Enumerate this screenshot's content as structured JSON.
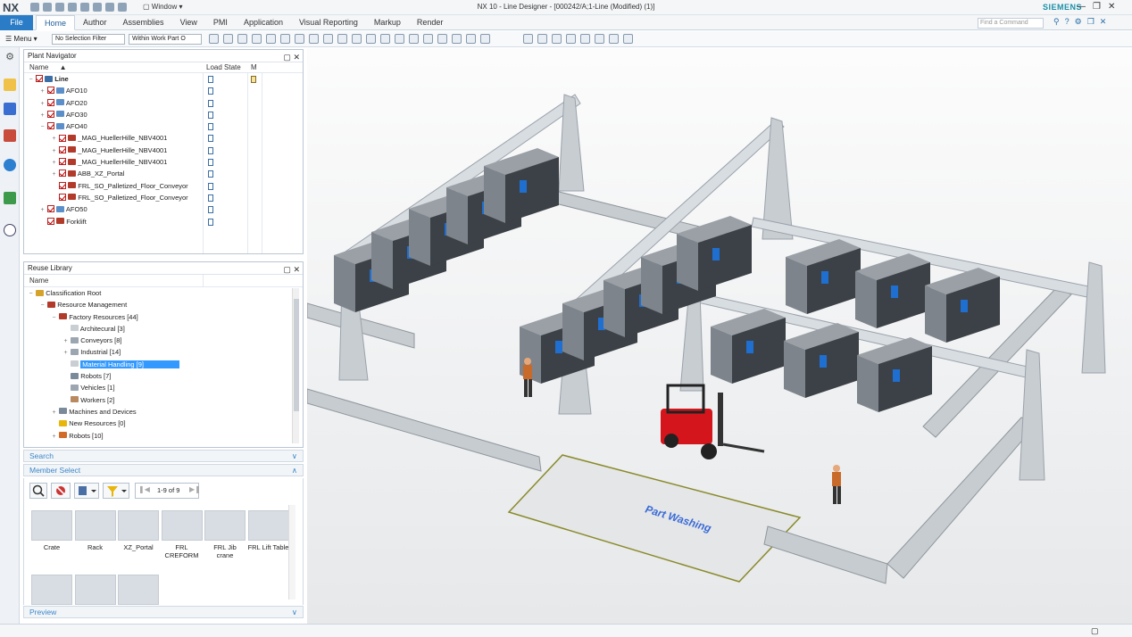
{
  "app": {
    "logo": "NX",
    "title": "NX 10 - Line Designer - [000242/A;1-Line (Modified)  (1)]",
    "brand": "SIEMENS",
    "window_menu": "Window"
  },
  "ribbon": {
    "file_tab": "File",
    "tabs": [
      "Home",
      "Author",
      "Assemblies",
      "View",
      "PMI",
      "Application",
      "Visual Reporting",
      "Markup",
      "Render"
    ],
    "active_tab": "Home",
    "find_command_placeholder": "Find a Command"
  },
  "toolbar": {
    "menu_label": "Menu",
    "selection_filter": "No Selection Filter",
    "scope": "Within Work Part O"
  },
  "plant_navigator": {
    "title": "Plant Navigator",
    "columns": {
      "name": "Name",
      "load_state": "Load State",
      "m": "M"
    },
    "rows": [
      {
        "label": "Line",
        "level": 0,
        "expander": "−",
        "icon": "line-icon"
      },
      {
        "label": "AFO10",
        "level": 1,
        "expander": "+",
        "icon": "station-icon"
      },
      {
        "label": "AFO20",
        "level": 1,
        "expander": "+",
        "icon": "station-icon"
      },
      {
        "label": "AFO30",
        "level": 1,
        "expander": "+",
        "icon": "station-icon"
      },
      {
        "label": "AFO40",
        "level": 1,
        "expander": "−",
        "icon": "station-icon"
      },
      {
        "label": "_MAG_HuellerHille_NBV4001",
        "level": 2,
        "expander": "+",
        "icon": "machine-icon"
      },
      {
        "label": "_MAG_HuellerHille_NBV4001",
        "level": 2,
        "expander": "+",
        "icon": "machine-icon"
      },
      {
        "label": "_MAG_HuellerHille_NBV4001",
        "level": 2,
        "expander": "+",
        "icon": "machine-icon"
      },
      {
        "label": "ABB_XZ_Portal",
        "level": 2,
        "expander": "+",
        "icon": "machine-icon"
      },
      {
        "label": "FRL_SO_Palletized_Floor_Conveyor",
        "level": 2,
        "expander": "",
        "icon": "machine-icon"
      },
      {
        "label": "FRL_SO_Palletized_Floor_Conveyor",
        "level": 2,
        "expander": "",
        "icon": "machine-icon"
      },
      {
        "label": "AFO50",
        "level": 1,
        "expander": "+",
        "icon": "station-icon"
      },
      {
        "label": "Forklift",
        "level": 1,
        "expander": "",
        "icon": "machine-icon"
      }
    ]
  },
  "reuse_library": {
    "title": "Reuse Library",
    "column_name": "Name",
    "rows": [
      {
        "label": "Classification Root",
        "level": 0,
        "expander": "−"
      },
      {
        "label": "Resource Management",
        "level": 1,
        "expander": "−"
      },
      {
        "label": "Factory Resources [44]",
        "level": 2,
        "expander": "−"
      },
      {
        "label": "Architecural [3]",
        "level": 3,
        "expander": ""
      },
      {
        "label": "Conveyors [8]",
        "level": 3,
        "expander": "+"
      },
      {
        "label": "Industrial [14]",
        "level": 3,
        "expander": "+"
      },
      {
        "label": "Material Handling [9]",
        "level": 3,
        "expander": "",
        "selected": true
      },
      {
        "label": "Robots [7]",
        "level": 3,
        "expander": ""
      },
      {
        "label": "Vehicles [1]",
        "level": 3,
        "expander": ""
      },
      {
        "label": "Workers [2]",
        "level": 3,
        "expander": ""
      },
      {
        "label": "Machines and Devices",
        "level": 2,
        "expander": "+"
      },
      {
        "label": "New Resources [0]",
        "level": 2,
        "expander": ""
      },
      {
        "label": "Robots [10]",
        "level": 2,
        "expander": "+"
      }
    ]
  },
  "sections": {
    "search": "Search",
    "member_select": "Member Select",
    "preview": "Preview"
  },
  "member_select": {
    "pager": "1-9 of 9",
    "tiles": [
      {
        "label": "Crate"
      },
      {
        "label": "Rack"
      },
      {
        "label": "XZ_Portal"
      },
      {
        "label": "FRL CREFORM"
      },
      {
        "label": "FRL Jib crane"
      },
      {
        "label": "FRL Lift Table"
      },
      {
        "label": ""
      },
      {
        "label": ""
      },
      {
        "label": ""
      }
    ]
  },
  "viewport": {
    "floor_label": "Part Washing"
  },
  "colors": {
    "accent": "#2a7cc7",
    "brand": "#1b8fa6",
    "selection": "#3399ff",
    "forklift": "#d4161c"
  }
}
